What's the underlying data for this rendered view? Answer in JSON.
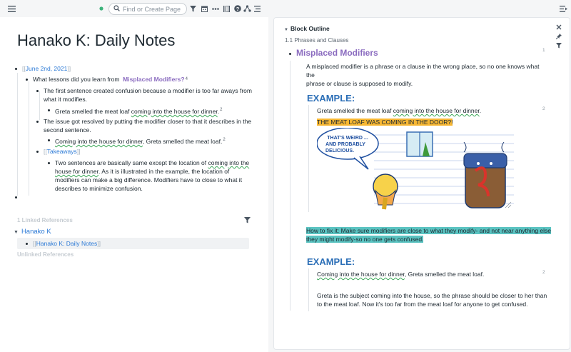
{
  "topbar": {
    "search_placeholder": "Find or Create Page"
  },
  "main": {
    "title": "Hanako K: Daily Notes",
    "date_link": "June 2nd, 2021",
    "question_prefix": "What lessons did you learn from",
    "question_link": "Misplaced Modifiers",
    "question_suffix": "?",
    "question_count": "4",
    "item1": "The first sentence created confusion because a modifier is too far aways from what it modifies.",
    "item1_child_ul": "coming into the house for dinner",
    "item1_child_pre": "Greta smelled the meat loaf ",
    "item1_child_post": ".",
    "item1_child_count": "2",
    "item2": "The issue got resolved by putting the modifier closer to that it describes in the second sentence.",
    "item2_child_ul": "Coming into the house for dinner",
    "item2_child_post": ", Greta smelled the meat loaf.",
    "item2_child_count": "2",
    "takeaways_link": "Takeaways",
    "take_line1_pre": "Two sentences are basically same except the location of ",
    "take_line1_ul": "coming into the",
    "take_line2_ul": "house for dinner",
    "take_line2_post": ". As it is illustrated in the example, the location of",
    "take_line3": "modifiers can make a big difference. Modifiers have to close to what it",
    "take_line4": "describes to minimize confusion.",
    "linked_refs": "1 Linked References",
    "ref_page": "Hanako K",
    "ref_block": "Hanako K: Daily Notes",
    "unlinked_refs": "Unlinked References"
  },
  "sidebar": {
    "title": "Block Outline",
    "breadcrumb": "1.1 Phrases and Clauses",
    "heading": "Misplaced Modifiers",
    "heading_count": "1",
    "definition_l1": "A misplaced modifier is a phrase or a clause in the wrong place, so no one knows what the",
    "definition_l2": "phrase or clause is supposed to modify.",
    "example1": "EXAMPLE:",
    "ex1_pre": "Greta smelled the meat loaf ",
    "ex1_ul": "coming into the house for dinner",
    "ex1_post": ".",
    "ex1_count": "2",
    "ex1_highlight": "THE MEAT LOAF WAS COMING IN THE DOOR?!",
    "bubble_l1": "THAT'S WEIRD ...",
    "bubble_l2": "AND PROBABLY",
    "bubble_l3": "DELICIOUS.",
    "fix_l1": "How to fix it: Make sure modifiers are close to what they modify- and not near anything else",
    "fix_l2": "they might modify-so no one gets confused.",
    "example2": "EXAMPLE:",
    "ex2_ul": "Coming into the house for dinner",
    "ex2_post": ", Greta smelled the meat loaf.",
    "ex2_count": "2",
    "explain_l1": "Greta is the subject coming into the house, so the phrase should be closer to her than",
    "explain_l2": "to the meat loaf. Now it's too far from the meat loaf for anyone to get confused."
  },
  "colors": {
    "link": "#2c7ad6",
    "purple": "#8a6bbf",
    "example_blue": "#2c6fb7",
    "highlight_orange": "#f7b733",
    "highlight_teal": "#5ac3c1"
  },
  "icons": [
    "menu-icon",
    "status-dot-icon",
    "search-icon",
    "filter-icon",
    "calendar-icon",
    "more-icon",
    "columns-icon",
    "help-icon",
    "graph-icon",
    "list-icon",
    "sidebar-toggle-icon",
    "close-icon",
    "pin-icon",
    "filter-icon"
  ]
}
